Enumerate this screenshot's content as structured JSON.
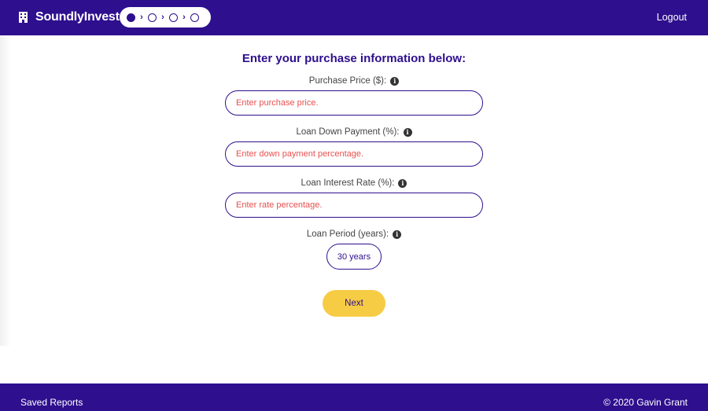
{
  "header": {
    "brand": "SoundlyInvest",
    "logout_label": "Logout",
    "steps": [
      {
        "state": "active"
      },
      {
        "state": "inactive"
      },
      {
        "state": "inactive"
      },
      {
        "state": "inactive"
      }
    ],
    "step_separator": "›"
  },
  "form": {
    "title": "Enter your purchase information below:",
    "purchase_price": {
      "label": "Purchase Price ($):",
      "placeholder": "Enter purchase price.",
      "value": ""
    },
    "down_payment": {
      "label": "Loan Down Payment (%):",
      "placeholder": "Enter down payment percentage.",
      "value": ""
    },
    "interest_rate": {
      "label": "Loan Interest Rate (%):",
      "placeholder": "Enter rate percentage.",
      "value": ""
    },
    "loan_period": {
      "label": "Loan Period (years):",
      "selected": "30 years"
    },
    "next_label": "Next",
    "info_glyph": "i"
  },
  "footer": {
    "saved_reports": "Saved Reports",
    "copyright": "© 2020 Gavin Grant"
  },
  "colors": {
    "primary": "#2e0f8e",
    "accent": "#f7cc45",
    "placeholder": "#e8504f"
  },
  "icons": {
    "brand": "building-icon",
    "info": "info-icon"
  }
}
